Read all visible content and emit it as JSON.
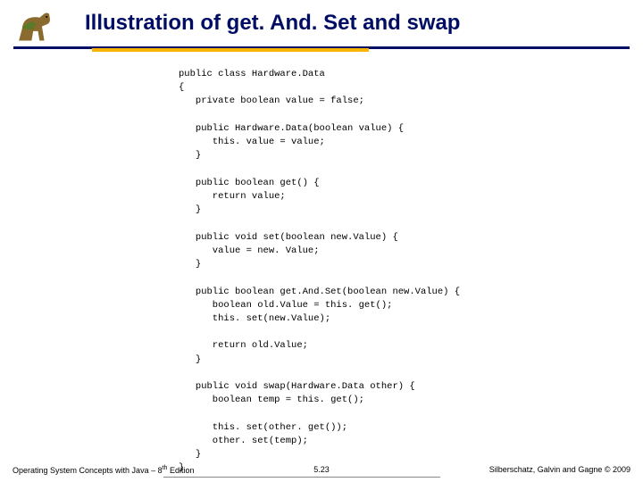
{
  "header": {
    "title": "Illustration of get. And. Set and swap"
  },
  "code": {
    "lines": "public class Hardware.Data\n{\n   private boolean value = false;\n\n   public Hardware.Data(boolean value) {\n      this. value = value;\n   }\n\n   public boolean get() {\n      return value;\n   }\n\n   public void set(boolean new.Value) {\n      value = new. Value;\n   }\n\n   public boolean get.And.Set(boolean new.Value) {\n      boolean old.Value = this. get();\n      this. set(new.Value);\n\n      return old.Value;\n   }\n\n   public void swap(Hardware.Data other) {\n      boolean temp = this. get();\n\n      this. set(other. get());\n      other. set(temp);\n   }\n}"
  },
  "footer": {
    "left_prefix": "Operating System Concepts with Java – 8",
    "left_sup": "th",
    "left_suffix": " Edition",
    "center": "5.23",
    "right_prefix": "Silberschatz, Galvin and Gagne ",
    "right_copy": "© 2009"
  }
}
